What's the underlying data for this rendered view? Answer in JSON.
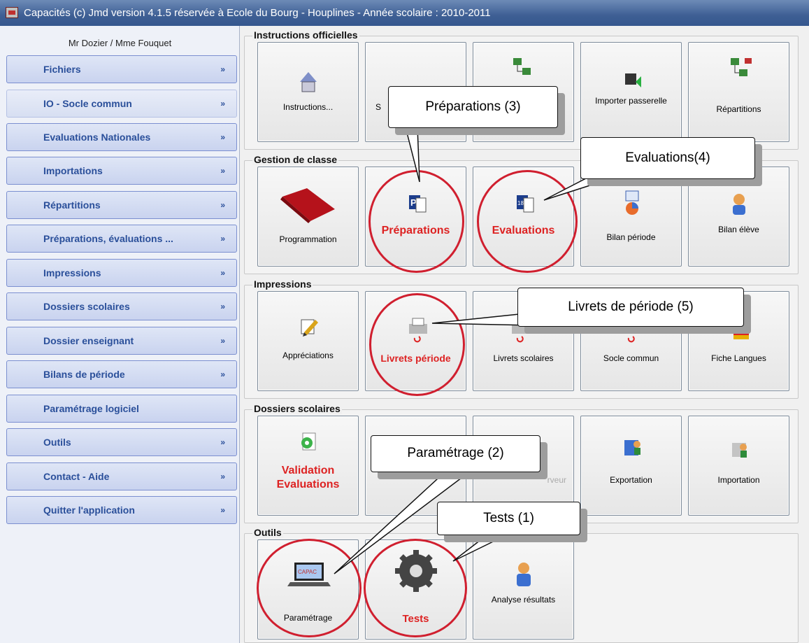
{
  "window": {
    "title": "Capacités (c) Jmd version 4.1.5 réservée à Ecole du Bourg - Houplines - Année scolaire : 2010-2011"
  },
  "sidebar": {
    "user": "Mr Dozier / Mme Fouquet",
    "chevron": "»",
    "items": [
      {
        "label": "Fichiers",
        "chevron": true
      },
      {
        "label": "IO - Socle commun",
        "chevron": true
      },
      {
        "label": "Evaluations Nationales",
        "chevron": true
      },
      {
        "label": "Importations",
        "chevron": true
      },
      {
        "label": "Répartitions",
        "chevron": true
      },
      {
        "label": "Préparations, évaluations ...",
        "chevron": true
      },
      {
        "label": "Impressions",
        "chevron": true
      },
      {
        "label": "Dossiers scolaires",
        "chevron": true
      },
      {
        "label": "Dossier enseignant",
        "chevron": true
      },
      {
        "label": "Bilans de période",
        "chevron": true
      },
      {
        "label": "Paramétrage logiciel",
        "chevron": false
      },
      {
        "label": "Outils",
        "chevron": true
      },
      {
        "label": "Contact - Aide",
        "chevron": true
      },
      {
        "label": "Quitter l'application",
        "chevron": true
      }
    ]
  },
  "groups": {
    "instructions": {
      "title": "Instructions officielles",
      "tiles": [
        "Instructions...",
        "S",
        "",
        "Importer passerelle",
        "Répartitions"
      ]
    },
    "gestion": {
      "title": "Gestion de classe",
      "tiles": [
        "Programmation",
        "Préparations",
        "Evaluations",
        "Bilan période",
        "Bilan élève"
      ]
    },
    "impressions": {
      "title": "Impressions",
      "tiles": [
        "Appréciations",
        "Livrets période",
        "Livrets scolaires",
        "Socle commun",
        "Fiche Langues"
      ]
    },
    "dossiers": {
      "title": "Dossiers scolaires",
      "tiles": [
        "Validation Evaluations",
        "",
        "rveur",
        "Exportation",
        "Importation"
      ]
    },
    "outils": {
      "title": "Outils",
      "tiles": [
        "Paramétrage",
        "Tests",
        "Analyse résultats"
      ]
    }
  },
  "callouts": {
    "preparations": "Préparations (3)",
    "evaluations": "Evaluations(4)",
    "livrets": "Livrets de période (5)",
    "parametrage": "Paramétrage (2)",
    "tests": "Tests (1)"
  },
  "colors": {
    "highlight": "#d01f2f",
    "nav_text": "#2a4f9a",
    "titlebar": "#3e5f94"
  }
}
